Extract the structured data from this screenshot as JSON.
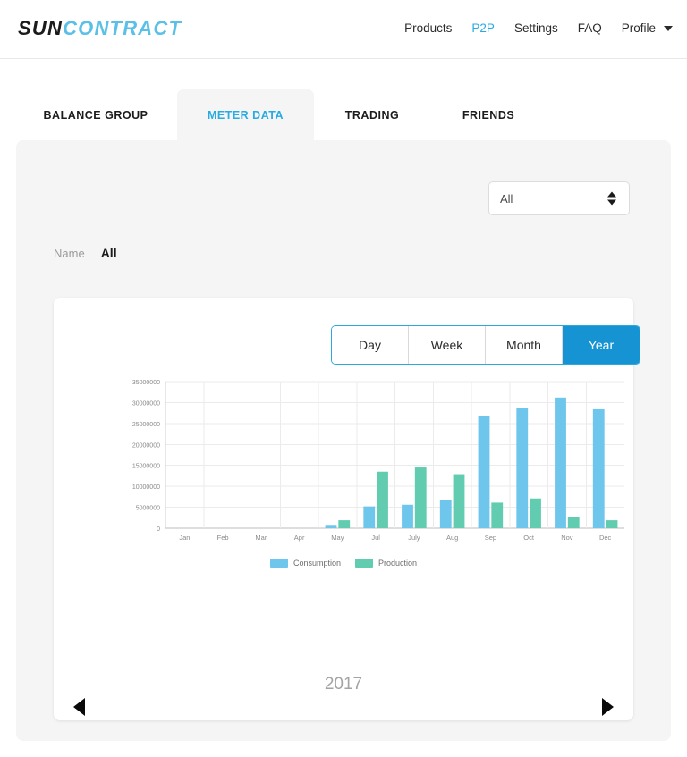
{
  "header": {
    "logo": {
      "part1": "SUN",
      "part2": "CONTRACT"
    },
    "nav": [
      {
        "label": "Products",
        "active": false
      },
      {
        "label": "P2P",
        "active": true
      },
      {
        "label": "Settings",
        "active": false
      },
      {
        "label": "FAQ",
        "active": false
      },
      {
        "label": "Profile",
        "active": false,
        "has_caret": true
      }
    ],
    "accent_color": "#29abe2"
  },
  "tabs": [
    {
      "label": "BALANCE GROUP",
      "active": false
    },
    {
      "label": "METER DATA",
      "active": true
    },
    {
      "label": "TRADING",
      "active": false
    },
    {
      "label": "FRIENDS",
      "active": false
    }
  ],
  "filter": {
    "selected": "All",
    "options": [
      "All"
    ]
  },
  "name_row": {
    "label": "Name",
    "value": "All"
  },
  "range_toggle": {
    "buttons": [
      {
        "label": "Day",
        "active": false
      },
      {
        "label": "Week",
        "active": false
      },
      {
        "label": "Month",
        "active": false
      },
      {
        "label": "Year",
        "active": true
      }
    ],
    "active_color": "#1693d2"
  },
  "year_nav": {
    "year": "2017",
    "prev_label": "previous-year",
    "next_label": "next-year"
  },
  "chart_data": {
    "type": "bar",
    "title": "",
    "xlabel": "",
    "ylabel": "",
    "grid": true,
    "legend_position": "bottom",
    "ylim": [
      0,
      35000000
    ],
    "yticks": [
      0,
      5000000,
      10000000,
      15000000,
      20000000,
      25000000,
      30000000,
      35000000
    ],
    "ytick_labels": [
      "0",
      "5000000",
      "10000000",
      "15000000",
      "20000000",
      "25000000",
      "30000000",
      "35000000"
    ],
    "categories": [
      "Jan",
      "Feb",
      "Mar",
      "Apr",
      "May",
      "Jul",
      "July",
      "Aug",
      "Sep",
      "Oct",
      "Nov",
      "Dec"
    ],
    "series": [
      {
        "name": "Consumption",
        "color": "#6ec6ec",
        "values": [
          0,
          0,
          0,
          0,
          800000,
          5200000,
          5600000,
          6700000,
          26800000,
          28800000,
          31200000,
          28400000
        ]
      },
      {
        "name": "Production",
        "color": "#62ccb0",
        "values": [
          0,
          0,
          0,
          0,
          1900000,
          13500000,
          14500000,
          12900000,
          6100000,
          7100000,
          2700000,
          1900000
        ]
      }
    ]
  }
}
